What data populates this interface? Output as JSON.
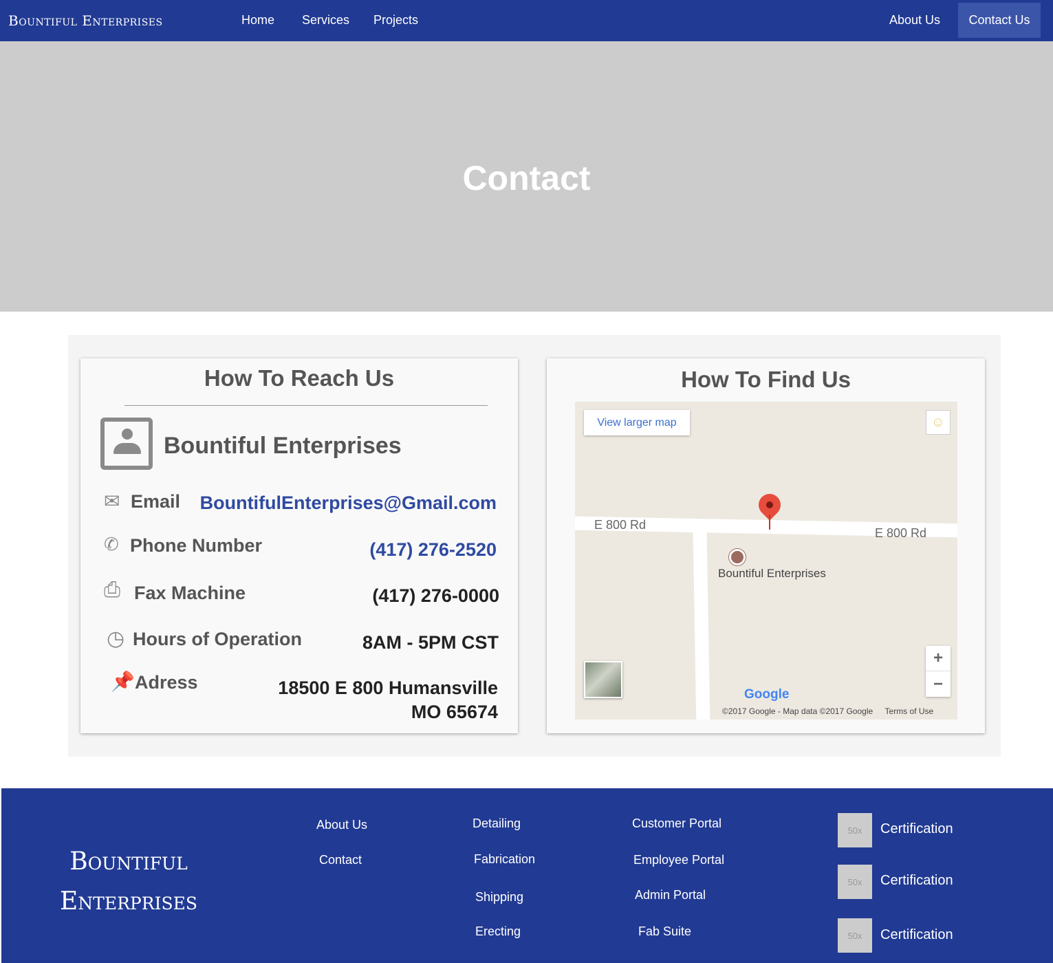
{
  "nav": {
    "brand": "Bountiful Enterprises",
    "links": [
      "Home",
      "Services",
      "Projects"
    ],
    "about": "About Us",
    "contact": "Contact Us"
  },
  "hero": {
    "title": "Contact"
  },
  "reach": {
    "title": "How To Reach Us",
    "company": "Bountiful Enterprises",
    "email_label": "Email",
    "email_value": "BountifulEnterprises@Gmail.com",
    "phone_label": "Phone Number",
    "phone_value": "(417) 276-2520",
    "fax_label": "Fax Machine",
    "fax_value": "(417) 276-0000",
    "hours_label": "Hours of Operation",
    "hours_value": "8AM - 5PM CST",
    "address_label": "Adress",
    "address_line1": "18500 E 800 Humansville",
    "address_line2": "MO 65674",
    "icons": [
      "contact-card-icon",
      "email-icon",
      "phone-icon",
      "fax-icon",
      "clock-icon",
      "pin-icon"
    ]
  },
  "find": {
    "title": "How To Find Us",
    "map": {
      "view_larger": "View larger map",
      "road_left": "E 800 Rd",
      "road_right": "E 800 Rd",
      "place": "Bountiful Enterprises",
      "zoom_in": "+",
      "zoom_out": "−",
      "logo": "Google",
      "attribution": "©2017 Google - Map data ©2017 Google",
      "terms": "Terms of Use"
    }
  },
  "footer": {
    "brand": "Bountiful Enterprises",
    "col1": [
      "About Us",
      "Contact"
    ],
    "col2": [
      "Detailing",
      "Fabrication",
      "Shipping",
      "Erecting"
    ],
    "col3": [
      "Customer Portal",
      "Employee Portal",
      "Admin Portal",
      "Fab Suite"
    ],
    "cert_placeholder": "50x",
    "certs": [
      "Certification",
      "Certification",
      "Certification"
    ]
  },
  "colors": {
    "brand_blue": "#213a93",
    "active_nav": "#3b55a8",
    "hero_gray": "#cccccc",
    "link_blue": "#2f4aa0"
  }
}
